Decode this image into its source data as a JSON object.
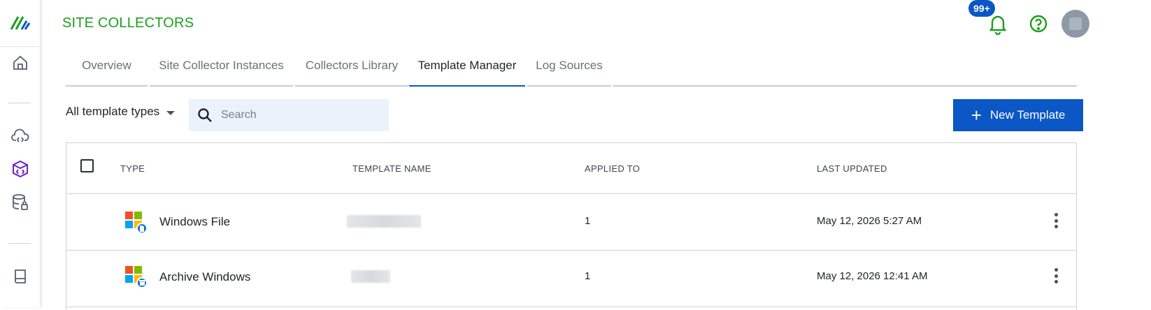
{
  "app": {
    "title": "SITE COLLECTORS"
  },
  "header": {
    "notification_count": "99+"
  },
  "tabs": [
    {
      "label": "Overview",
      "active": false
    },
    {
      "label": "Site Collector Instances",
      "active": false
    },
    {
      "label": "Collectors Library",
      "active": false
    },
    {
      "label": "Template Manager",
      "active": true
    },
    {
      "label": "Log Sources",
      "active": false
    }
  ],
  "toolbar": {
    "filter_label": "All template types",
    "search_placeholder": "Search",
    "new_button_label": "New Template"
  },
  "table": {
    "columns": [
      "TYPE",
      "TEMPLATE NAME",
      "APPLIED TO",
      "LAST UPDATED"
    ],
    "rows": [
      {
        "type": "Windows File",
        "template_name": "",
        "applied_to": "1",
        "last_updated": "May 12, 2026 5:27 AM"
      },
      {
        "type": "Archive Windows",
        "template_name": "",
        "applied_to": "1",
        "last_updated": "May 12, 2026 12:41 AM"
      }
    ]
  },
  "colors": {
    "brand_green": "#1a9f1a",
    "primary_blue": "#0b57c5",
    "nav_purple": "#6d1fd1"
  }
}
